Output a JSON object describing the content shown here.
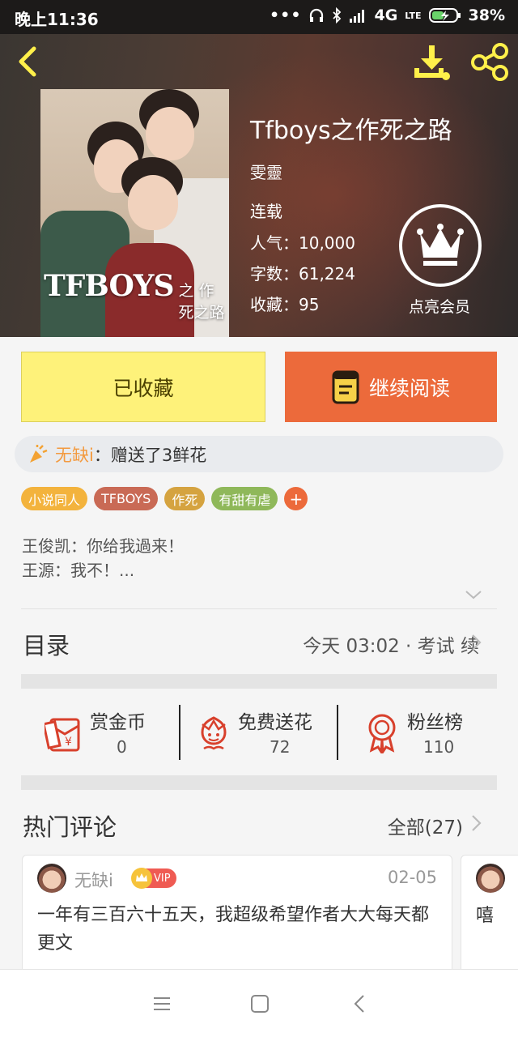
{
  "status_bar": {
    "time": "晚上11:36",
    "network": "4G",
    "volte": "LTE",
    "battery": "38%"
  },
  "book": {
    "title": "Tfboys之作死之路",
    "author": "雯靈",
    "status": "连载",
    "popularity": "人气：10,000",
    "word_count": "字数：61,224",
    "favorites": "收藏：95",
    "cover_text_main": "TFBOYS",
    "cover_text_sub": "之 作死之路"
  },
  "vip": {
    "label": "点亮会员"
  },
  "actions": {
    "collected_label": "已收藏",
    "continue_label": "继续阅读"
  },
  "gift": {
    "user": "无缺i",
    "text": "：赠送了3鲜花"
  },
  "tags": [
    {
      "label": "小说同人",
      "color": "#f3b33d"
    },
    {
      "label": "TFBOYS",
      "color": "#c96a55"
    },
    {
      "label": "作死",
      "color": "#d5a340"
    },
    {
      "label": "有甜有虐",
      "color": "#8fb85a"
    }
  ],
  "tag_add_label": "+",
  "intro": {
    "line1": "王俊凯：你给我過来！",
    "line2": "王源：我不！..."
  },
  "toc": {
    "label": "目录",
    "latest": "今天 03:02 · 考试  续"
  },
  "stats": [
    {
      "label": "赏金币",
      "value": "0",
      "icon": "red-envelope-icon"
    },
    {
      "label": "免费送花",
      "value": "72",
      "icon": "flower-icon"
    },
    {
      "label": "粉丝榜",
      "value": "110",
      "icon": "ribbon-medal-icon"
    }
  ],
  "comments": {
    "section_label": "热门评论",
    "all_label": "全部(27)",
    "items": [
      {
        "user": "无缺i",
        "badge": "VIP",
        "date": "02-05",
        "text": "一年有三百六十五天，我超级希望作者大大每天都更文"
      },
      {
        "text_preview": "嘻"
      }
    ]
  },
  "colors": {
    "accent_orange": "#ec6a3b",
    "collected_yellow": "#fef27a",
    "gift_user": "#f39a3f"
  }
}
